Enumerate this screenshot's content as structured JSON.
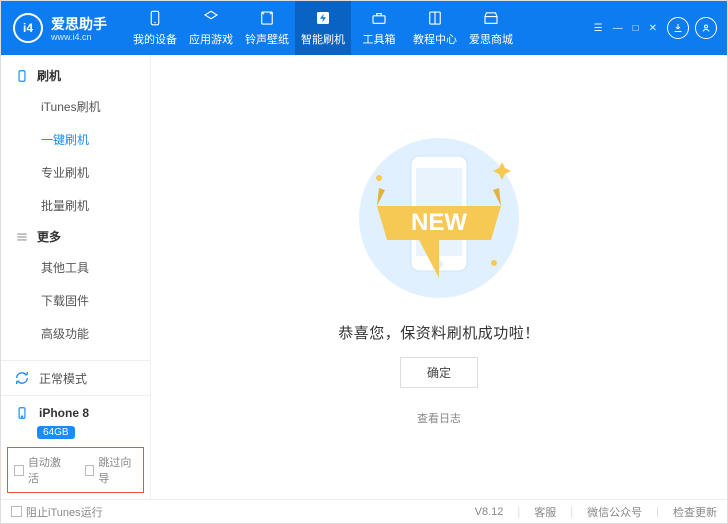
{
  "app": {
    "name": "爱思助手",
    "domain": "www.i4.cn",
    "logo_mark": "i4"
  },
  "nav": [
    {
      "id": "devices",
      "label": "我的设备",
      "icon": "phone"
    },
    {
      "id": "apps",
      "label": "应用游戏",
      "icon": "apps"
    },
    {
      "id": "ringtones",
      "label": "铃声壁纸",
      "icon": "note"
    },
    {
      "id": "flash",
      "label": "智能刷机",
      "icon": "flash"
    },
    {
      "id": "tools",
      "label": "工具箱",
      "icon": "toolbox"
    },
    {
      "id": "tutorial",
      "label": "教程中心",
      "icon": "book"
    },
    {
      "id": "mall",
      "label": "爱思商城",
      "icon": "store"
    }
  ],
  "active_nav": "flash",
  "sidebar": {
    "groups": [
      {
        "id": "flash",
        "label": "刷机",
        "icon": "phone",
        "items": [
          {
            "id": "itunes",
            "label": "iTunes刷机"
          },
          {
            "id": "one",
            "label": "一键刷机"
          },
          {
            "id": "pro",
            "label": "专业刷机"
          },
          {
            "id": "batch",
            "label": "批量刷机"
          }
        ],
        "active_item": "one"
      },
      {
        "id": "more",
        "label": "更多",
        "icon": "list",
        "items": [
          {
            "id": "other",
            "label": "其他工具"
          },
          {
            "id": "download",
            "label": "下载固件"
          },
          {
            "id": "advanced",
            "label": "高级功能"
          }
        ]
      }
    ],
    "device": {
      "mode": "正常模式",
      "name": "iPhone 8",
      "storage": "64GB"
    },
    "options": {
      "auto_activate": "自动激活",
      "skip_guide": "跳过向导"
    }
  },
  "main": {
    "banner_text": "NEW",
    "success_text": "恭喜您，保资料刷机成功啦！",
    "ok_button": "确定",
    "view_log": "查看日志"
  },
  "footer": {
    "block_itunes": "阻止iTunes运行",
    "version": "V8.12",
    "support": "客服",
    "wechat": "微信公众号",
    "update": "检查更新"
  }
}
